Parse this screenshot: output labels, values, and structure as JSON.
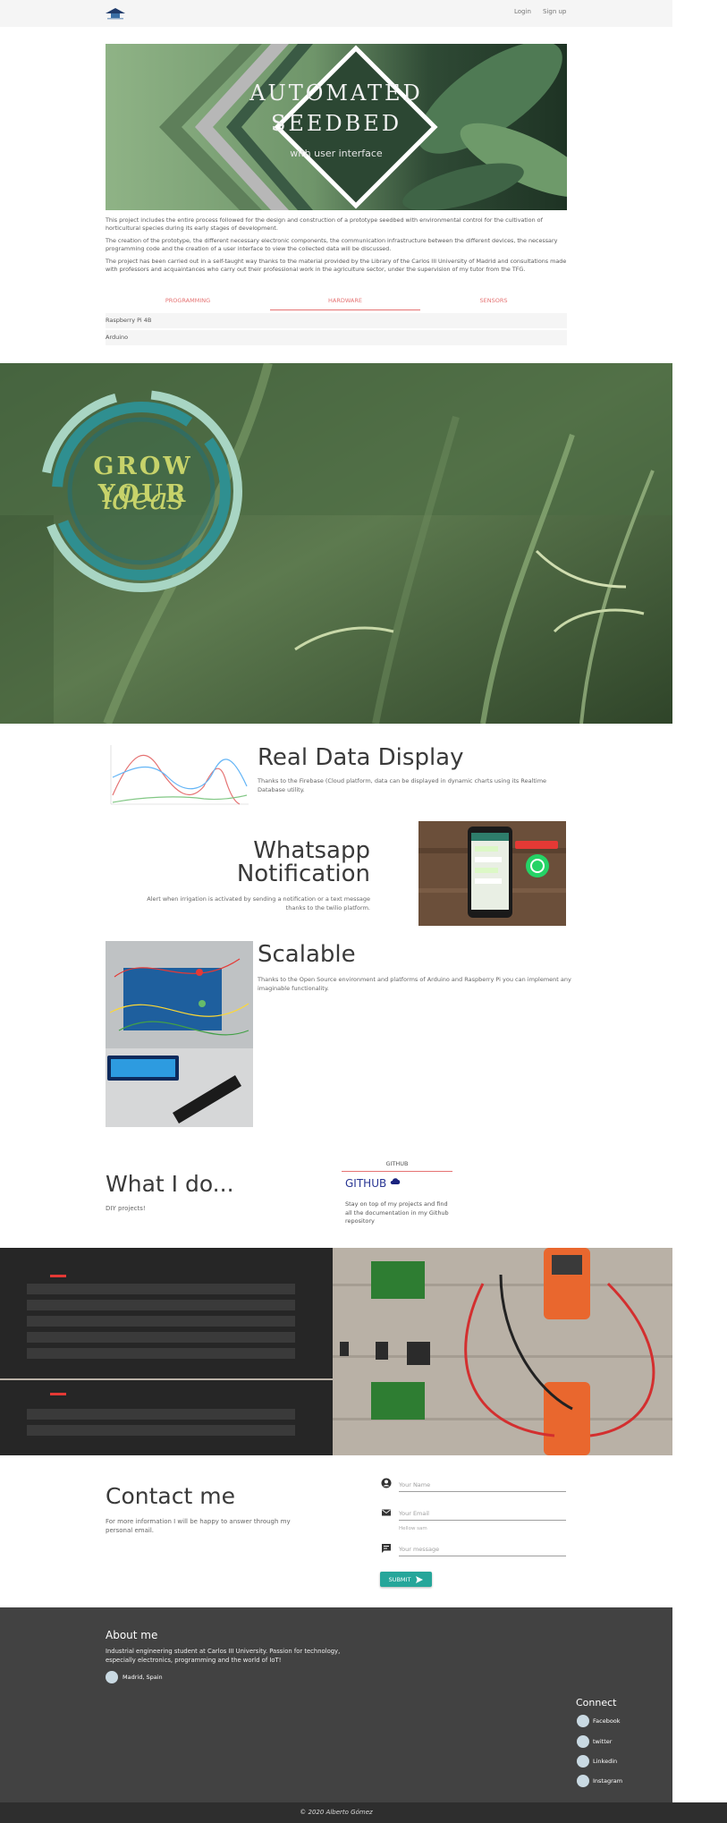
{
  "nav": {
    "login": "Login",
    "signup": "Sign up"
  },
  "banner": {
    "title_line1": "AUTOMATED",
    "title_line2": "SEEDBED",
    "subtitle": "with user interface"
  },
  "intro": {
    "p1": "This project includes the entire process followed for the design and construction of a prototype seedbed with environmental control for the cultivation of horticultural species during its early stages of development.",
    "p2": "The creation of the prototype, the different necessary electronic components, the communication infrastructure between the different devices, the necessary programming code and the creation of a user interface to view the collected data will be discussed.",
    "p3": "The project has been carried out in a self-taught way thanks to the material provided by the Library of the Carlos III University of Madrid and consultations made with professors and acquaintances who carry out their professional work in the agriculture sector, under the supervision of my tutor from the TFG."
  },
  "tabs": [
    "PROGRAMMING",
    "HARDWARE",
    "SENSORS"
  ],
  "hardware_list": [
    "Raspberry Pi 4B",
    "Arduino"
  ],
  "parallax1": {
    "logo_line1": "GROW YOUR",
    "logo_line2": "ideas"
  },
  "features": {
    "realdata": {
      "title": "Real Data Display",
      "text": "Thanks to the Firebase (Cloud platform, data can be displayed in dynamic charts using its Realtime Database utility."
    },
    "whatsapp": {
      "title_line1": "Whatsapp",
      "title_line2": "Notification",
      "text_line1": "Alert when irrigation is activated by sending a notification or a text message",
      "text_line2": "thanks to the twilio platform."
    },
    "scalable": {
      "title": "Scalable",
      "text": "Thanks to the Open Source environment and platforms of Arduino and Raspberry Pi you can implement any imaginable functionality."
    }
  },
  "what": {
    "title": "What I do...",
    "subtitle": "DIY projects!",
    "card": {
      "header": "GITHUB",
      "title": "GITHUB",
      "icon": "cloud-icon",
      "text": "Stay on top of my projects and find all the documentation in my Github repository"
    }
  },
  "contact": {
    "title": "Contact me",
    "text": "For more information I will be happy to answer through my personal email.",
    "name_placeholder": "Your Name",
    "email_placeholder": "Your Email",
    "email_helper": "Hellow sam",
    "message_placeholder": "Your message",
    "submit": "SUBMIT"
  },
  "footer": {
    "about_title": "About me",
    "about_text": "Industrial engineering student at Carlos III University. Passion for technology, especially electronics, programming and the world of IoT!",
    "location": "Madrid, Spain",
    "connect_title": "Connect",
    "social": [
      "Facebook",
      "twitter",
      "Linkedin",
      "Instagram"
    ],
    "copyright": "© 2020 Alberto Gómez"
  },
  "colors": {
    "accent": "#e57373",
    "teal": "#26a69a",
    "footer": "#424242",
    "card_title": "#283593"
  }
}
